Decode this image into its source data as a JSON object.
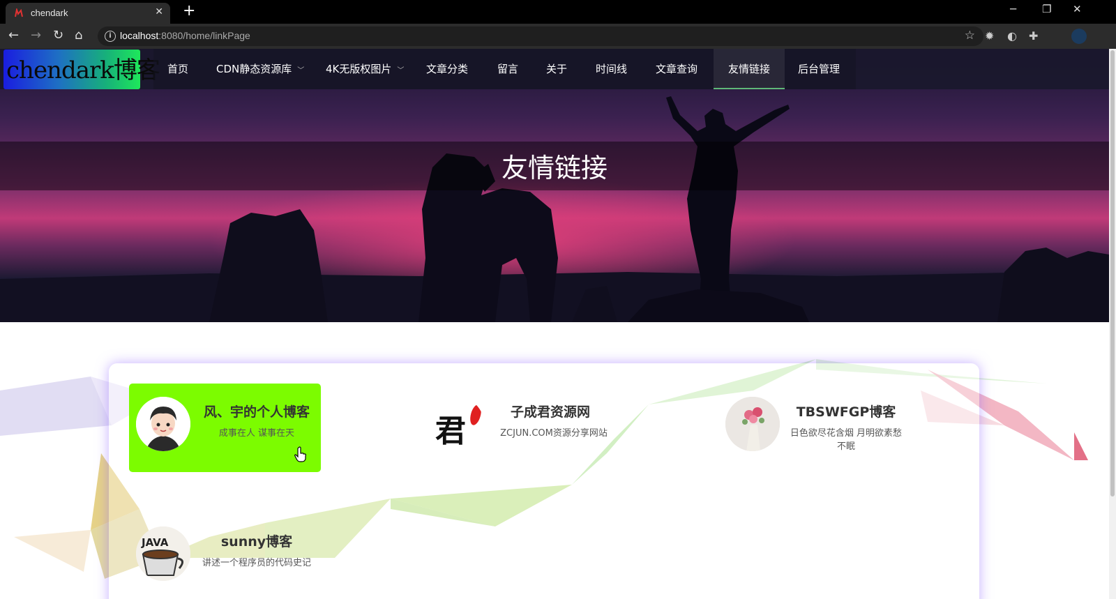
{
  "browser": {
    "tab_title": "chendark",
    "url_host": "localhost",
    "url_path": ":8080/home/linkPage"
  },
  "site": {
    "logo_text": "chendark博客",
    "menu": [
      {
        "label": "首页"
      },
      {
        "label": "CDN静态资源库"
      },
      {
        "label": "4K无版权图片"
      },
      {
        "label": "文章分类"
      },
      {
        "label": "留言"
      },
      {
        "label": "关于"
      },
      {
        "label": "时间线"
      },
      {
        "label": "文章查询"
      },
      {
        "label": "友情链接"
      },
      {
        "label": "后台管理"
      }
    ],
    "active_menu": "友情链接"
  },
  "hero": {
    "title": "友情链接"
  },
  "links": [
    {
      "name": "风、宇的个人博客",
      "desc": "成事在人 谋事在天"
    },
    {
      "name": "子成君资源网",
      "desc": "ZCJUN.COM资源分享网站"
    },
    {
      "name": "TBSWFGP博客",
      "desc": "日色欲尽花含烟 月明欲素愁不眠"
    },
    {
      "name": "sunny博客",
      "desc": "讲述一个程序员的代码史记"
    }
  ],
  "colors": {
    "highlight": "#7cfc00",
    "nav_active": "#5fb878",
    "card_glow": "#9f6eff"
  }
}
